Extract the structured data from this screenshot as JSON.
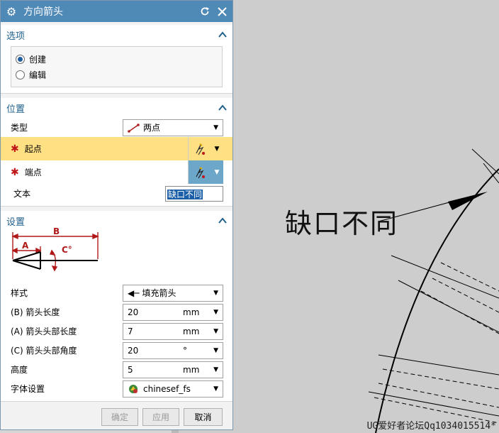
{
  "dialog": {
    "title": "方向箭头",
    "icons": {
      "gear": "gear-icon",
      "reset": "reset-icon",
      "close": "close-icon"
    }
  },
  "options": {
    "header": "选项",
    "items": [
      {
        "label": "创建",
        "selected": true
      },
      {
        "label": "编辑",
        "selected": false
      }
    ]
  },
  "position": {
    "header": "位置",
    "type_label": "类型",
    "type_value": "两点",
    "start_label": "起点",
    "end_label": "端点",
    "text_label": "文本",
    "text_value": "缺口不同"
  },
  "settings": {
    "header": "设置",
    "diagram": {
      "a": "A",
      "b": "B",
      "c": "C°"
    },
    "style_label": "样式",
    "style_value": "填充箭头",
    "arrow_length_label": "(B) 箭头长度",
    "arrow_length_value": "20",
    "arrow_length_unit": "mm",
    "head_length_label": "(A) 箭头头部长度",
    "head_length_value": "7",
    "head_length_unit": "mm",
    "head_angle_label": "(C) 箭头头部角度",
    "head_angle_value": "20",
    "head_angle_unit": "°",
    "height_label": "高度",
    "height_value": "5",
    "height_unit": "mm",
    "font_label": "字体设置",
    "font_value": "chinesef_fs"
  },
  "footer": {
    "ok": "确定",
    "apply": "应用",
    "cancel": "取消"
  },
  "canvas": {
    "annotation_text": "缺口不同",
    "watermark": "UG爱好者论坛Qq1034015514*"
  },
  "colors": {
    "title_bar": "#4f89b6",
    "section_header": "#1f5f8b",
    "active_row": "#ffe184",
    "required_star": "#c01818"
  }
}
